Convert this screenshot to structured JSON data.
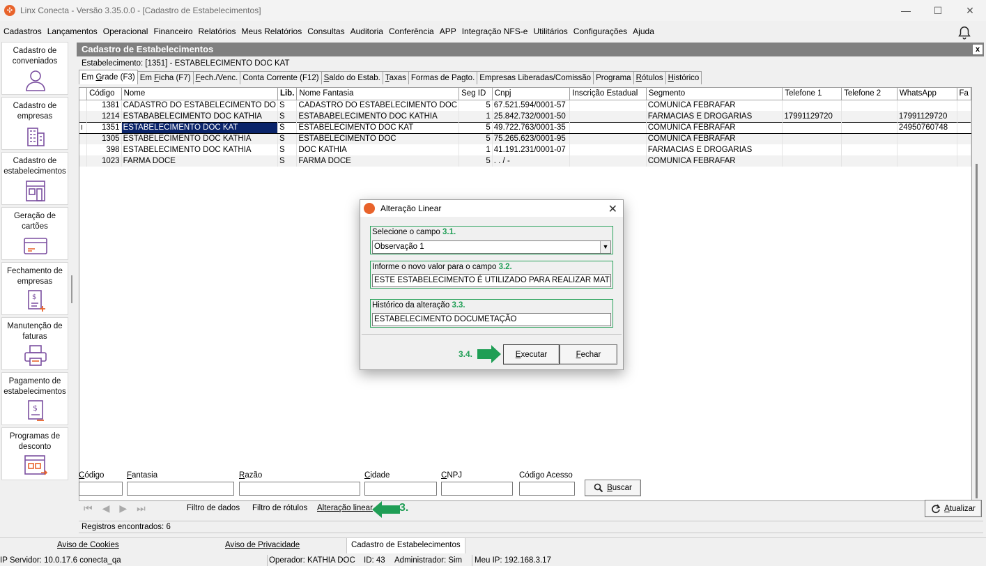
{
  "window": {
    "title": "Linx Conecta - Versão 3.35.0.0 - [Cadastro de Estabelecimentos]",
    "controls": [
      "—",
      "☐",
      "✕"
    ]
  },
  "menu": [
    "Cadastros",
    "Lançamentos",
    "Operacional",
    "Financeiro",
    "Relatórios",
    "Meus Relatórios",
    "Consultas",
    "Auditoria",
    "Conferência",
    "APP",
    "Integração NFS-e",
    "Utilitários",
    "Configurações",
    "Ajuda"
  ],
  "sidebar": [
    {
      "label": "Cadastro de conveniados",
      "icon": "person-icon"
    },
    {
      "label": "Cadastro de empresas",
      "icon": "building-icon"
    },
    {
      "label": "Cadastro de estabelecimentos",
      "icon": "store-icon"
    },
    {
      "label": "Geração de cartões",
      "icon": "card-icon"
    },
    {
      "label": "Fechamento de empresas",
      "icon": "invoice-plus-icon"
    },
    {
      "label": "Manutenção de faturas",
      "icon": "printer-icon"
    },
    {
      "label": "Pagamento de estabelecimentos",
      "icon": "payment-icon"
    },
    {
      "label": "Programas de desconto",
      "icon": "discount-program-icon"
    }
  ],
  "main": {
    "header": "Cadastro de Estabelecimentos",
    "close": "x",
    "estabelecimento": "Estabelecimento: [1351] - ESTABELECIMENTO DOC KAT",
    "tabs": [
      {
        "pre": "Em ",
        "u": "G",
        "post": "rade (F3)",
        "active": true
      },
      {
        "pre": "Em ",
        "u": "F",
        "post": "icha (F7)"
      },
      {
        "pre": "",
        "u": "F",
        "post": "ech./Venc."
      },
      {
        "pre": "Conta Corrente (F12)",
        "u": "",
        "post": ""
      },
      {
        "pre": "",
        "u": "S",
        "post": "aldo do Estab."
      },
      {
        "pre": "",
        "u": "T",
        "post": "axas"
      },
      {
        "pre": "Formas de Pagto.",
        "u": "",
        "post": ""
      },
      {
        "pre": "Empresas Liberadas/Comissão",
        "u": "",
        "post": ""
      },
      {
        "pre": "Programa",
        "u": "",
        "post": ""
      },
      {
        "pre": "",
        "u": "R",
        "post": "ótulos"
      },
      {
        "pre": "",
        "u": "H",
        "post": "istórico"
      }
    ],
    "grid": {
      "columns": [
        "Código",
        "Nome",
        "Lib.",
        "Nome Fantasia",
        "Seg ID",
        "Cnpj",
        "Inscrição Estadual",
        "Segmento",
        "Telefone 1",
        "Telefone 2",
        "WhatsApp",
        "Fa"
      ],
      "rows": [
        [
          "1381",
          "CADASTRO DO ESTABELECIMENTO DO",
          "S",
          "CADASTRO DO ESTABELECIMENTO DOC",
          "5",
          "67.521.594/0001-57",
          "",
          "COMUNICA FEBRAFAR",
          "",
          "",
          "",
          ""
        ],
        [
          "1214",
          "ESTABABELECIMENTO DOC KATHIA",
          "S",
          "ESTABABELECIMENTO DOC KATHIA",
          "1",
          "25.842.732/0001-50",
          "",
          "FARMACIAS E DROGARIAS",
          "17991129720",
          "",
          "17991129720",
          ""
        ],
        [
          "1351",
          "ESTABELECIMENTO DOC KAT",
          "S",
          "ESTABELECIMENTO DOC KAT",
          "5",
          "49.722.763/0001-35",
          "",
          "COMUNICA FEBRAFAR",
          "",
          "",
          "24950760748",
          ""
        ],
        [
          "1305",
          "ESTABELECIMENTO DOC KATHIA",
          "S",
          "ESTABELECIMENTO DOC",
          "5",
          "75.265.623/0001-95",
          "",
          "COMUNICA FEBRAFAR",
          "",
          "",
          "",
          ""
        ],
        [
          "398",
          "ESTABELECIMENTO DOC KATHIA",
          "S",
          "DOC KATHIA",
          "1",
          "41.191.231/0001-07",
          "",
          "FARMACIAS E DROGARIAS",
          "",
          "",
          "",
          ""
        ],
        [
          "1023",
          "FARMA DOCE",
          "S",
          "FARMA DOCE",
          "5",
          " .  .   /    -",
          "",
          "COMUNICA FEBRAFAR",
          "",
          "",
          "",
          ""
        ]
      ],
      "selected_row": 2
    },
    "filters": [
      {
        "u": "C",
        "rest": "ódigo"
      },
      {
        "u": "F",
        "rest": "antasia"
      },
      {
        "u": "R",
        "rest": "azão"
      },
      {
        "u": "C",
        "rest": "idade"
      },
      {
        "u": "C",
        "rest": "NPJ"
      },
      {
        "u": "",
        "rest": "Código Acesso"
      }
    ],
    "buscar": {
      "u": "B",
      "rest": "uscar"
    },
    "nav_buttons": [
      "⏮",
      "◀",
      "▶",
      "⏭"
    ],
    "links": {
      "filtro_dados": "Filtro de dados",
      "filtro_rotulos": "Filtro de rótulos",
      "alteracao_linear": "Alteração linear"
    },
    "atualizar": {
      "u": "A",
      "rest": "tualizar"
    },
    "status": "Registros encontrados: 6"
  },
  "callouts": {
    "step3": "3.",
    "step31": "3.1.",
    "step32": "3.2.",
    "step33": "3.3.",
    "step34": "3.4."
  },
  "dialog": {
    "title": "Alteração Linear",
    "field1_label": "Selecione o campo",
    "field1_value": "Observação 1",
    "field2_label": "Informe o novo valor para o campo",
    "field2_value": "ESTE ESTABELECIMENTO É UTILIZADO PARA REALIZAR MATERIAIS",
    "field3_label": "Histórico da alteração",
    "field3_value": "ESTABELECIMENTO DOCUMETAÇÃO",
    "executar": {
      "u": "E",
      "rest": "xecutar"
    },
    "fechar": {
      "u": "F",
      "rest": "echar"
    }
  },
  "footer": {
    "tabs": [
      "Aviso de Cookies",
      "Aviso de Privacidade",
      "Cadastro de Estabelecimentos"
    ],
    "status": {
      "ip": "IP Servidor: 10.0.17.6 conecta_qa",
      "operador": "Operador: KATHIA DOC",
      "id": "ID: 43",
      "admin": "Administrador: Sim",
      "meuip": "Meu IP: 192.168.3.17"
    }
  },
  "colors": {
    "accent_green": "#1f9e55",
    "header_gray": "#808080",
    "selection": "#0a246a",
    "logo_orange": "#e8632b"
  }
}
